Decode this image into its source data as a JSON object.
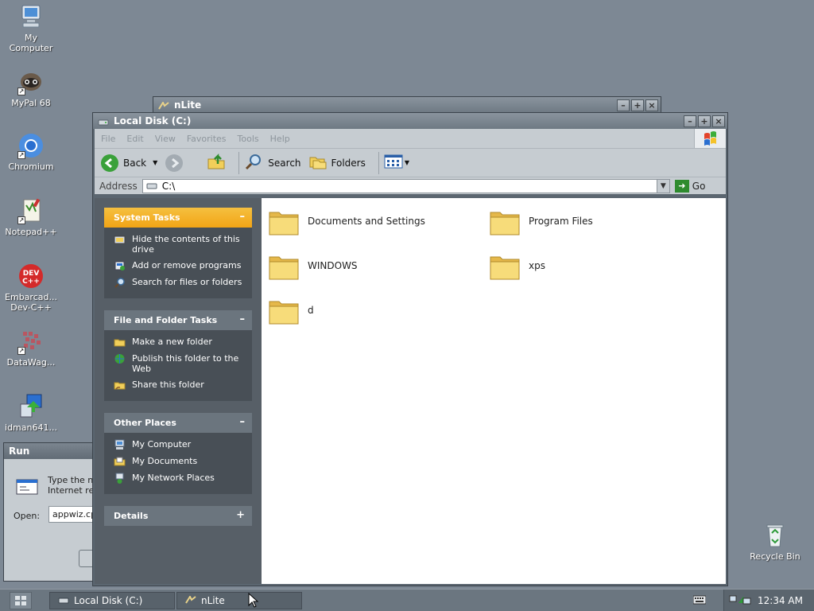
{
  "desktop": {
    "icons": [
      {
        "label": "My\nComputer",
        "icon": "computer-icon"
      },
      {
        "label": "MyPal 68",
        "icon": "raccoon-icon"
      },
      {
        "label": "Chromium",
        "icon": "chromium-icon"
      },
      {
        "label": "Notepad++",
        "icon": "notepad-icon"
      },
      {
        "label": "Embarcad...\nDev-C++",
        "icon": "devcpp-icon"
      },
      {
        "label": "DataWag...",
        "icon": "datawag-icon"
      },
      {
        "label": "idman641...",
        "icon": "idman-icon"
      },
      {
        "label": "Recycle Bin",
        "icon": "recycle-bin-icon"
      }
    ]
  },
  "nlite_window": {
    "title": "nLite"
  },
  "run_dialog": {
    "title": "Run",
    "description": "Type the na\nInternet res",
    "open_label": "Open:",
    "open_value": "appwiz.cpl"
  },
  "explorer": {
    "title": "Local Disk (C:)",
    "menu": [
      "File",
      "Edit",
      "View",
      "Favorites",
      "Tools",
      "Help"
    ],
    "toolbar": {
      "back": "Back",
      "search": "Search",
      "folders": "Folders"
    },
    "address_label": "Address",
    "address_value": "C:\\",
    "go_label": "Go",
    "taskpane": {
      "system_tasks": {
        "title": "System Tasks",
        "items": [
          "Hide the contents of this drive",
          "Add or remove programs",
          "Search for files or folders"
        ]
      },
      "file_folder_tasks": {
        "title": "File and Folder Tasks",
        "items": [
          "Make a new folder",
          "Publish this folder to the Web",
          "Share this folder"
        ]
      },
      "other_places": {
        "title": "Other Places",
        "items": [
          "My Computer",
          "My Documents",
          "My Network Places"
        ]
      },
      "details": {
        "title": "Details"
      }
    },
    "folders": [
      "Documents and Settings",
      "Program Files",
      "WINDOWS",
      "xps",
      "d"
    ]
  },
  "taskbar": {
    "tasks": [
      "Local Disk (C:)",
      "nLite"
    ],
    "clock": "12:34 AM"
  },
  "colors": {
    "desktop": "#7d8894",
    "accent_orange": "#f2a415",
    "folder_yellow": "#f5d76a"
  }
}
